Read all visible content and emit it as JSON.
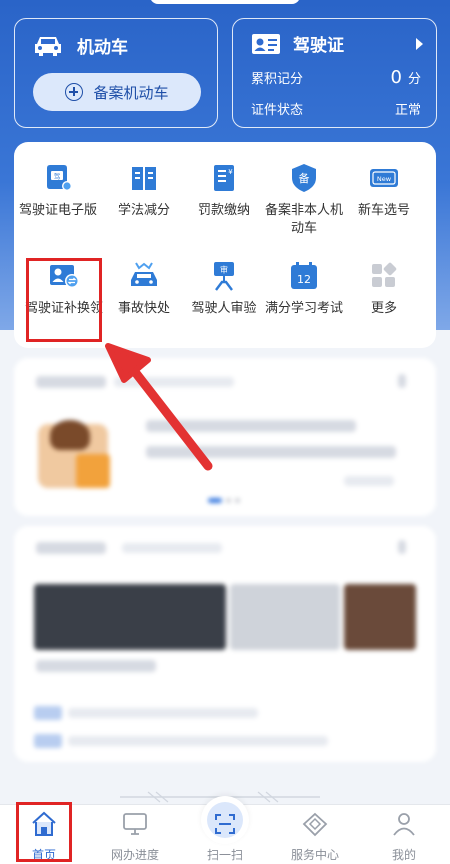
{
  "vehicle_card": {
    "title": "机动车",
    "register_button": "备案机动车"
  },
  "license_card": {
    "title": "驾驶证",
    "points_label": "累积记分",
    "points_value": "0",
    "points_unit": "分",
    "status_label": "证件状态",
    "status_value": "正常"
  },
  "services": [
    {
      "label": "驾驶证电子版",
      "icon": "e-license-icon"
    },
    {
      "label": "学法减分",
      "icon": "study-book-icon"
    },
    {
      "label": "罚款缴纳",
      "icon": "fine-payment-icon"
    },
    {
      "label": "备案非本人机动车",
      "icon": "register-shield-icon"
    },
    {
      "label": "新车选号",
      "icon": "new-plate-icon"
    },
    {
      "label": "驾驶证补换领",
      "icon": "license-replace-icon"
    },
    {
      "label": "事故快处",
      "icon": "accident-car-icon"
    },
    {
      "label": "驾驶人审验",
      "icon": "driver-review-icon"
    },
    {
      "label": "满分学习考试",
      "icon": "calendar-12-icon"
    },
    {
      "label": "更多",
      "icon": "more-grid-icon"
    }
  ],
  "tabs": [
    {
      "label": "首页",
      "icon": "home-icon",
      "active": true
    },
    {
      "label": "网办进度",
      "icon": "monitor-icon",
      "active": false
    },
    {
      "label": "扫一扫",
      "icon": "scan-icon",
      "active": false
    },
    {
      "label": "服务中心",
      "icon": "handshake-icon",
      "active": false
    },
    {
      "label": "我的",
      "icon": "user-icon",
      "active": false
    }
  ],
  "colors": {
    "primary": "#2f6bd0",
    "highlight": "#e02424",
    "header": "#2a64c8"
  }
}
